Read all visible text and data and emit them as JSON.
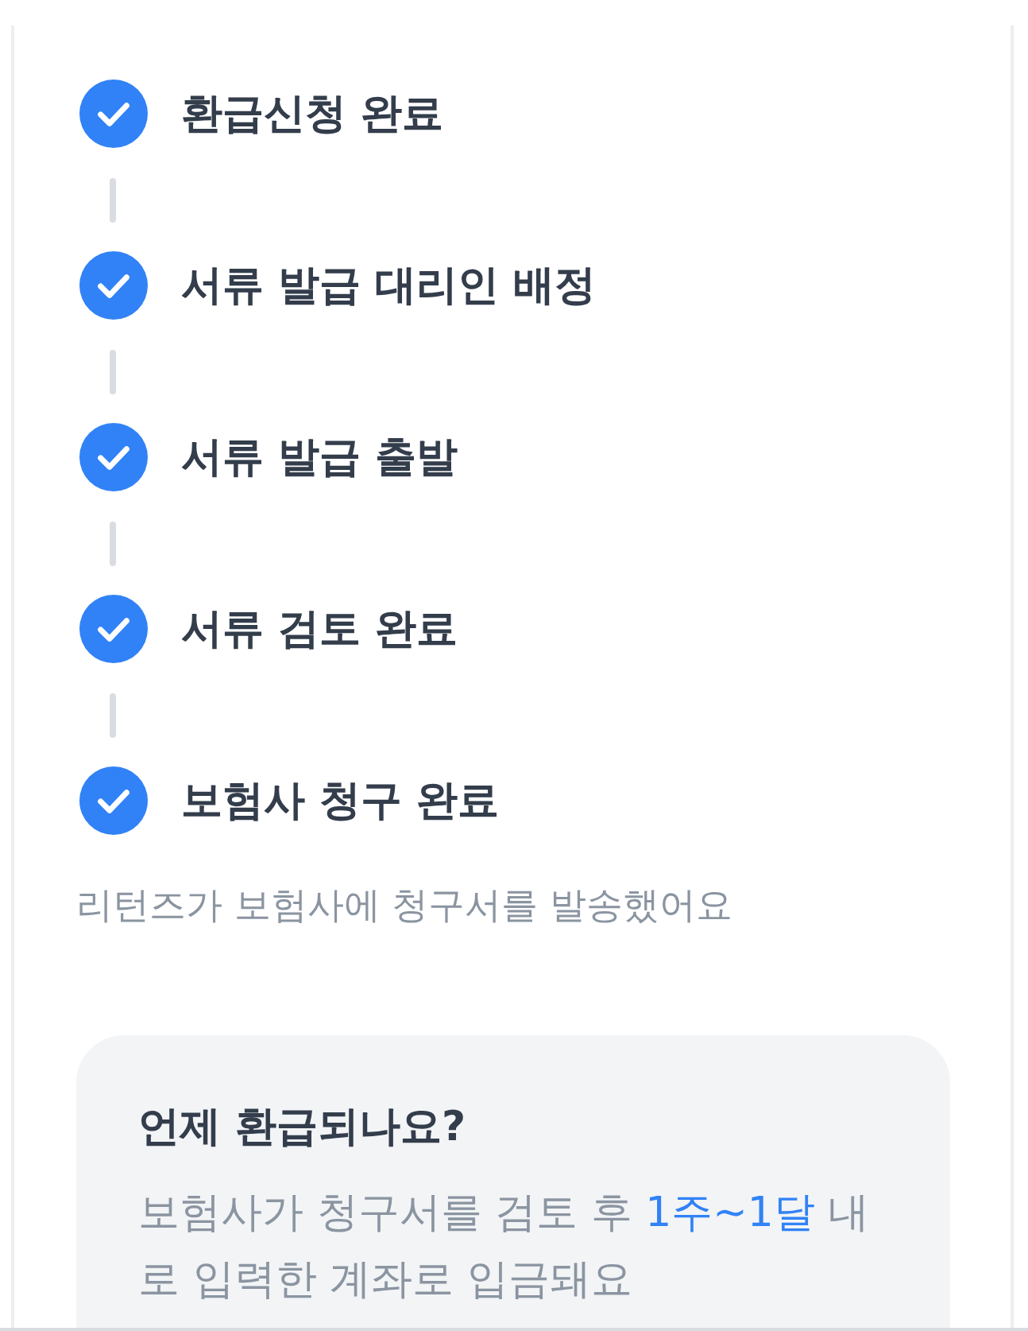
{
  "steps": [
    {
      "label": "환급신청 완료",
      "done": true
    },
    {
      "label": "서류 발급 대리인 배정",
      "done": true
    },
    {
      "label": "서류 발급 출발",
      "done": true
    },
    {
      "label": "서류 검토 완료",
      "done": true
    },
    {
      "label": "보험사 청구 완료",
      "done": true,
      "description": "리턴즈가 보험사에 청구서를 발송했어요"
    }
  ],
  "info_card": {
    "title": "언제 환급되나요?",
    "body": "보험사가 청구서를 검토 후 **1주~1달** 내로 입력한 계좌로 입금돼요"
  }
}
